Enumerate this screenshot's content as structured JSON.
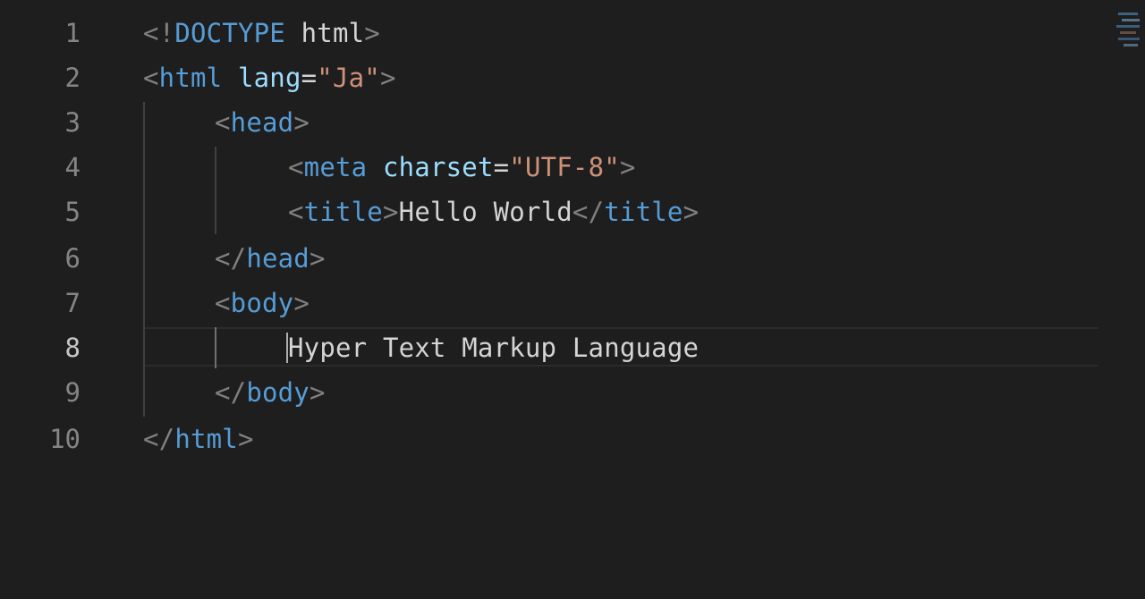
{
  "editor": {
    "line_numbers": [
      "1",
      "2",
      "3",
      "4",
      "5",
      "6",
      "7",
      "8",
      "9",
      "10"
    ],
    "active_line": 8,
    "lines": {
      "l1": {
        "lt": "<",
        "bang": "!",
        "doctype": "DOCTYPE",
        "space": " ",
        "word": "html",
        "gt": ">"
      },
      "l2": {
        "lt": "<",
        "tag": "html",
        "space": " ",
        "attr": "lang",
        "eq": "=",
        "value": "\"Ja\"",
        "gt": ">"
      },
      "l3": {
        "lt": "<",
        "tag": "head",
        "gt": ">"
      },
      "l4": {
        "lt": "<",
        "tag": "meta",
        "space": " ",
        "attr": "charset",
        "eq": "=",
        "value": "\"UTF-8\"",
        "gt": ">"
      },
      "l5": {
        "lt": "<",
        "tag": "title",
        "gt": ">",
        "text": "Hello World",
        "close_lt": "</",
        "close_tag": "title",
        "close_gt": ">"
      },
      "l6": {
        "lt": "</",
        "tag": "head",
        "gt": ">"
      },
      "l7": {
        "lt": "<",
        "tag": "body",
        "gt": ">"
      },
      "l8": {
        "text": "Hyper Text Markup Language"
      },
      "l9": {
        "lt": "</",
        "tag": "body",
        "gt": ">"
      },
      "l10": {
        "lt": "</",
        "tag": "html",
        "gt": ">"
      }
    }
  },
  "colors": {
    "background": "#1e1e1e",
    "tag": "#569cd6",
    "attribute": "#9cdcfe",
    "string": "#ce9178",
    "punctuation": "#808080",
    "text": "#d4d4d4",
    "line_number": "#858585",
    "active_line_number": "#c6c6c6"
  },
  "icons": {
    "minimap": "minimap-icon"
  }
}
